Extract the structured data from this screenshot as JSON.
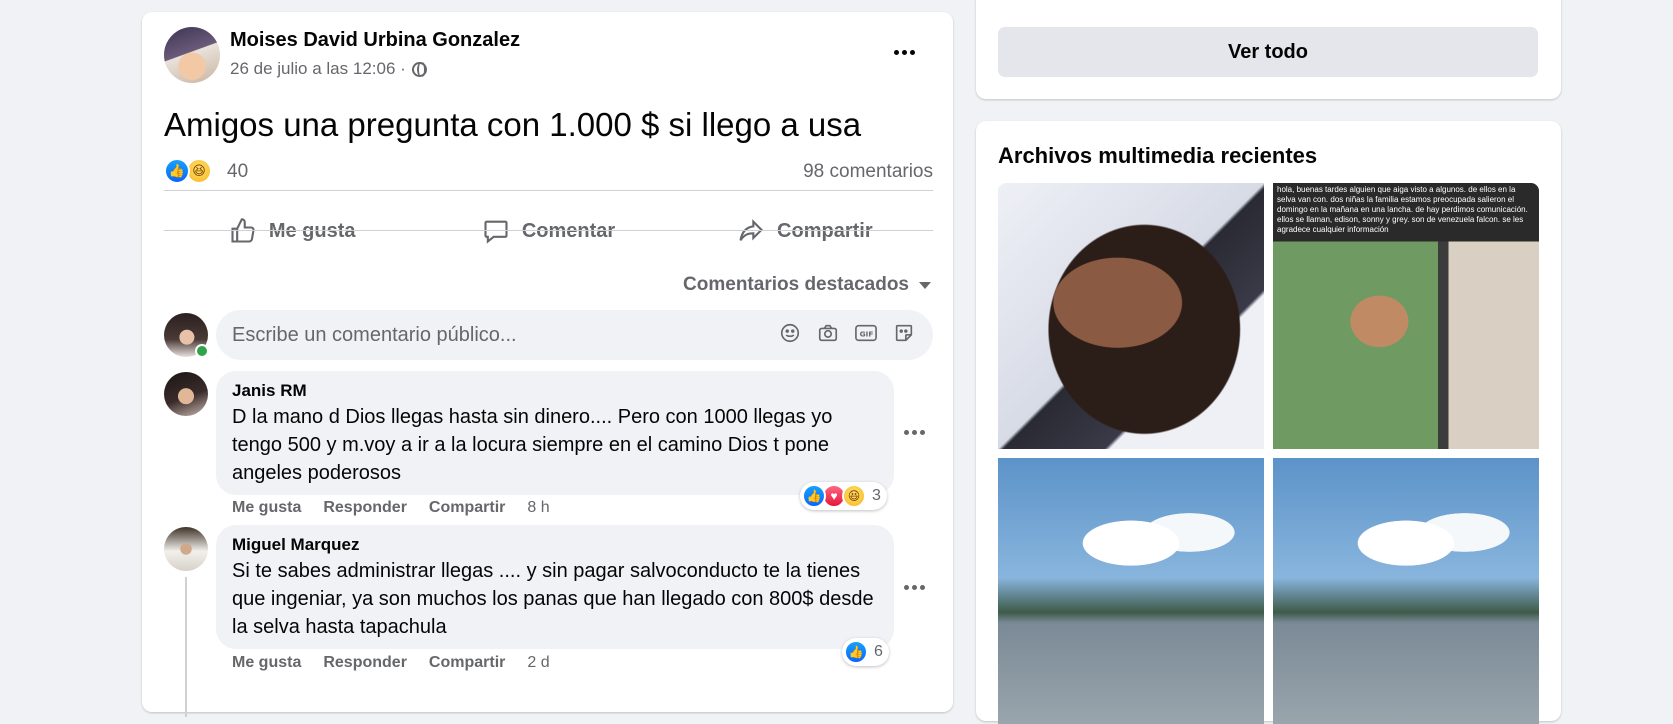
{
  "post": {
    "author": "Moises David Urbina Gonzalez",
    "timestamp": "26 de julio a las 12:06 ·",
    "privacy_icon": "globe-icon",
    "text": "Amigos una pregunta con 1.000 $ si llego a usa",
    "reaction_count": "40",
    "comment_count": "98 comentarios",
    "actions": {
      "like": "Me gusta",
      "comment": "Comentar",
      "share": "Compartir"
    },
    "sort_label": "Comentarios destacados",
    "comment_placeholder": "Escribe un comentario público..."
  },
  "comments": [
    {
      "name": "Janis RM",
      "text": "D la mano d Dios llegas hasta sin dinero.... Pero con 1000 llegas yo tengo 500 y m.voy a ir a la locura siempre en el camino Dios t pone angeles poderosos",
      "like": "Me gusta",
      "reply": "Responder",
      "share": "Compartir",
      "time": "8 h",
      "reactions": "3"
    },
    {
      "name": "Miguel Marquez",
      "text": "Si te sabes administrar llegas .... y sin pagar salvoconducto te la tienes que ingeniar, ya son muchos los panas que han llegado con 800$ desde la selva hasta tapachula",
      "like": "Me gusta",
      "reply": "Responder",
      "share": "Compartir",
      "time": "2 d",
      "reactions": "6"
    }
  ],
  "sidebar": {
    "see_all": "Ver todo",
    "media_title": "Archivos multimedia recientes",
    "media_caption": "hola, buenas tardes alguien que aiga visto a algunos. de ellos en la selva van con. dos niñas la familia estamos preocupada salieron el domingo en la mañana en una lancha. de hay perdimos comunicación. ellos se llaman, edison, sonny y grey. son de venezuela falcon. se les agradece cualquier información"
  },
  "colors": {
    "background": "#f0f2f5",
    "card": "#ffffff",
    "secondary_text": "#65676b",
    "like_blue": "#0766ff",
    "online_green": "#31a24c"
  }
}
